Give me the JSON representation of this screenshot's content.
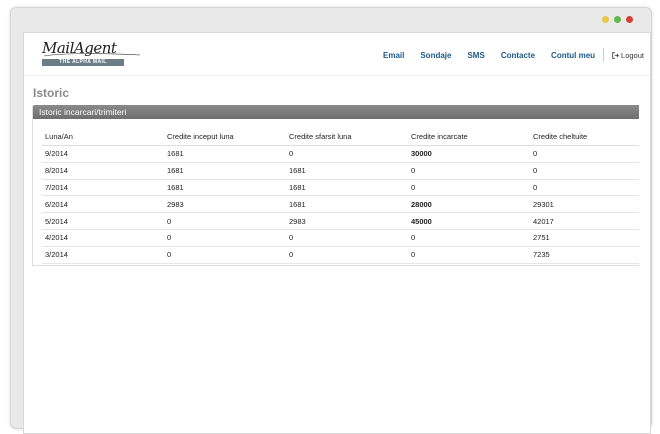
{
  "window": {
    "controls": [
      {
        "name": "minimize",
        "color": "#e8c94a"
      },
      {
        "name": "maximize",
        "color": "#5fb94c"
      },
      {
        "name": "close",
        "color": "#d7403a"
      }
    ]
  },
  "header": {
    "logo_text": "MailAgent",
    "logo_tagline": "THE ALPHA MAIL",
    "nav": [
      "Email",
      "Sondaje",
      "SMS",
      "Contacte",
      "Contul meu"
    ],
    "logout_label": "Logout"
  },
  "page_title": "Istoric",
  "panel_title": "Istoric incarcari/trimiteri",
  "table": {
    "columns": [
      "Luna/An",
      "Credite inceput luna",
      "Credite sfarsit luna",
      "Credite incarcate",
      "Credite cheltuite"
    ],
    "rows": [
      [
        "9/2014",
        "1681",
        "0",
        "30000",
        "0"
      ],
      [
        "8/2014",
        "1681",
        "1681",
        "0",
        "0"
      ],
      [
        "7/2014",
        "1681",
        "1681",
        "0",
        "0"
      ],
      [
        "6/2014",
        "2983",
        "1681",
        "28000",
        "29301"
      ],
      [
        "5/2014",
        "0",
        "2983",
        "45000",
        "42017"
      ],
      [
        "4/2014",
        "0",
        "0",
        "0",
        "2751"
      ],
      [
        "3/2014",
        "0",
        "0",
        "0",
        "7235"
      ]
    ]
  },
  "colors": {
    "nav_link": "#1e5a8a",
    "panel_header": "#7a7a7a",
    "title": "#8a8a8a"
  }
}
